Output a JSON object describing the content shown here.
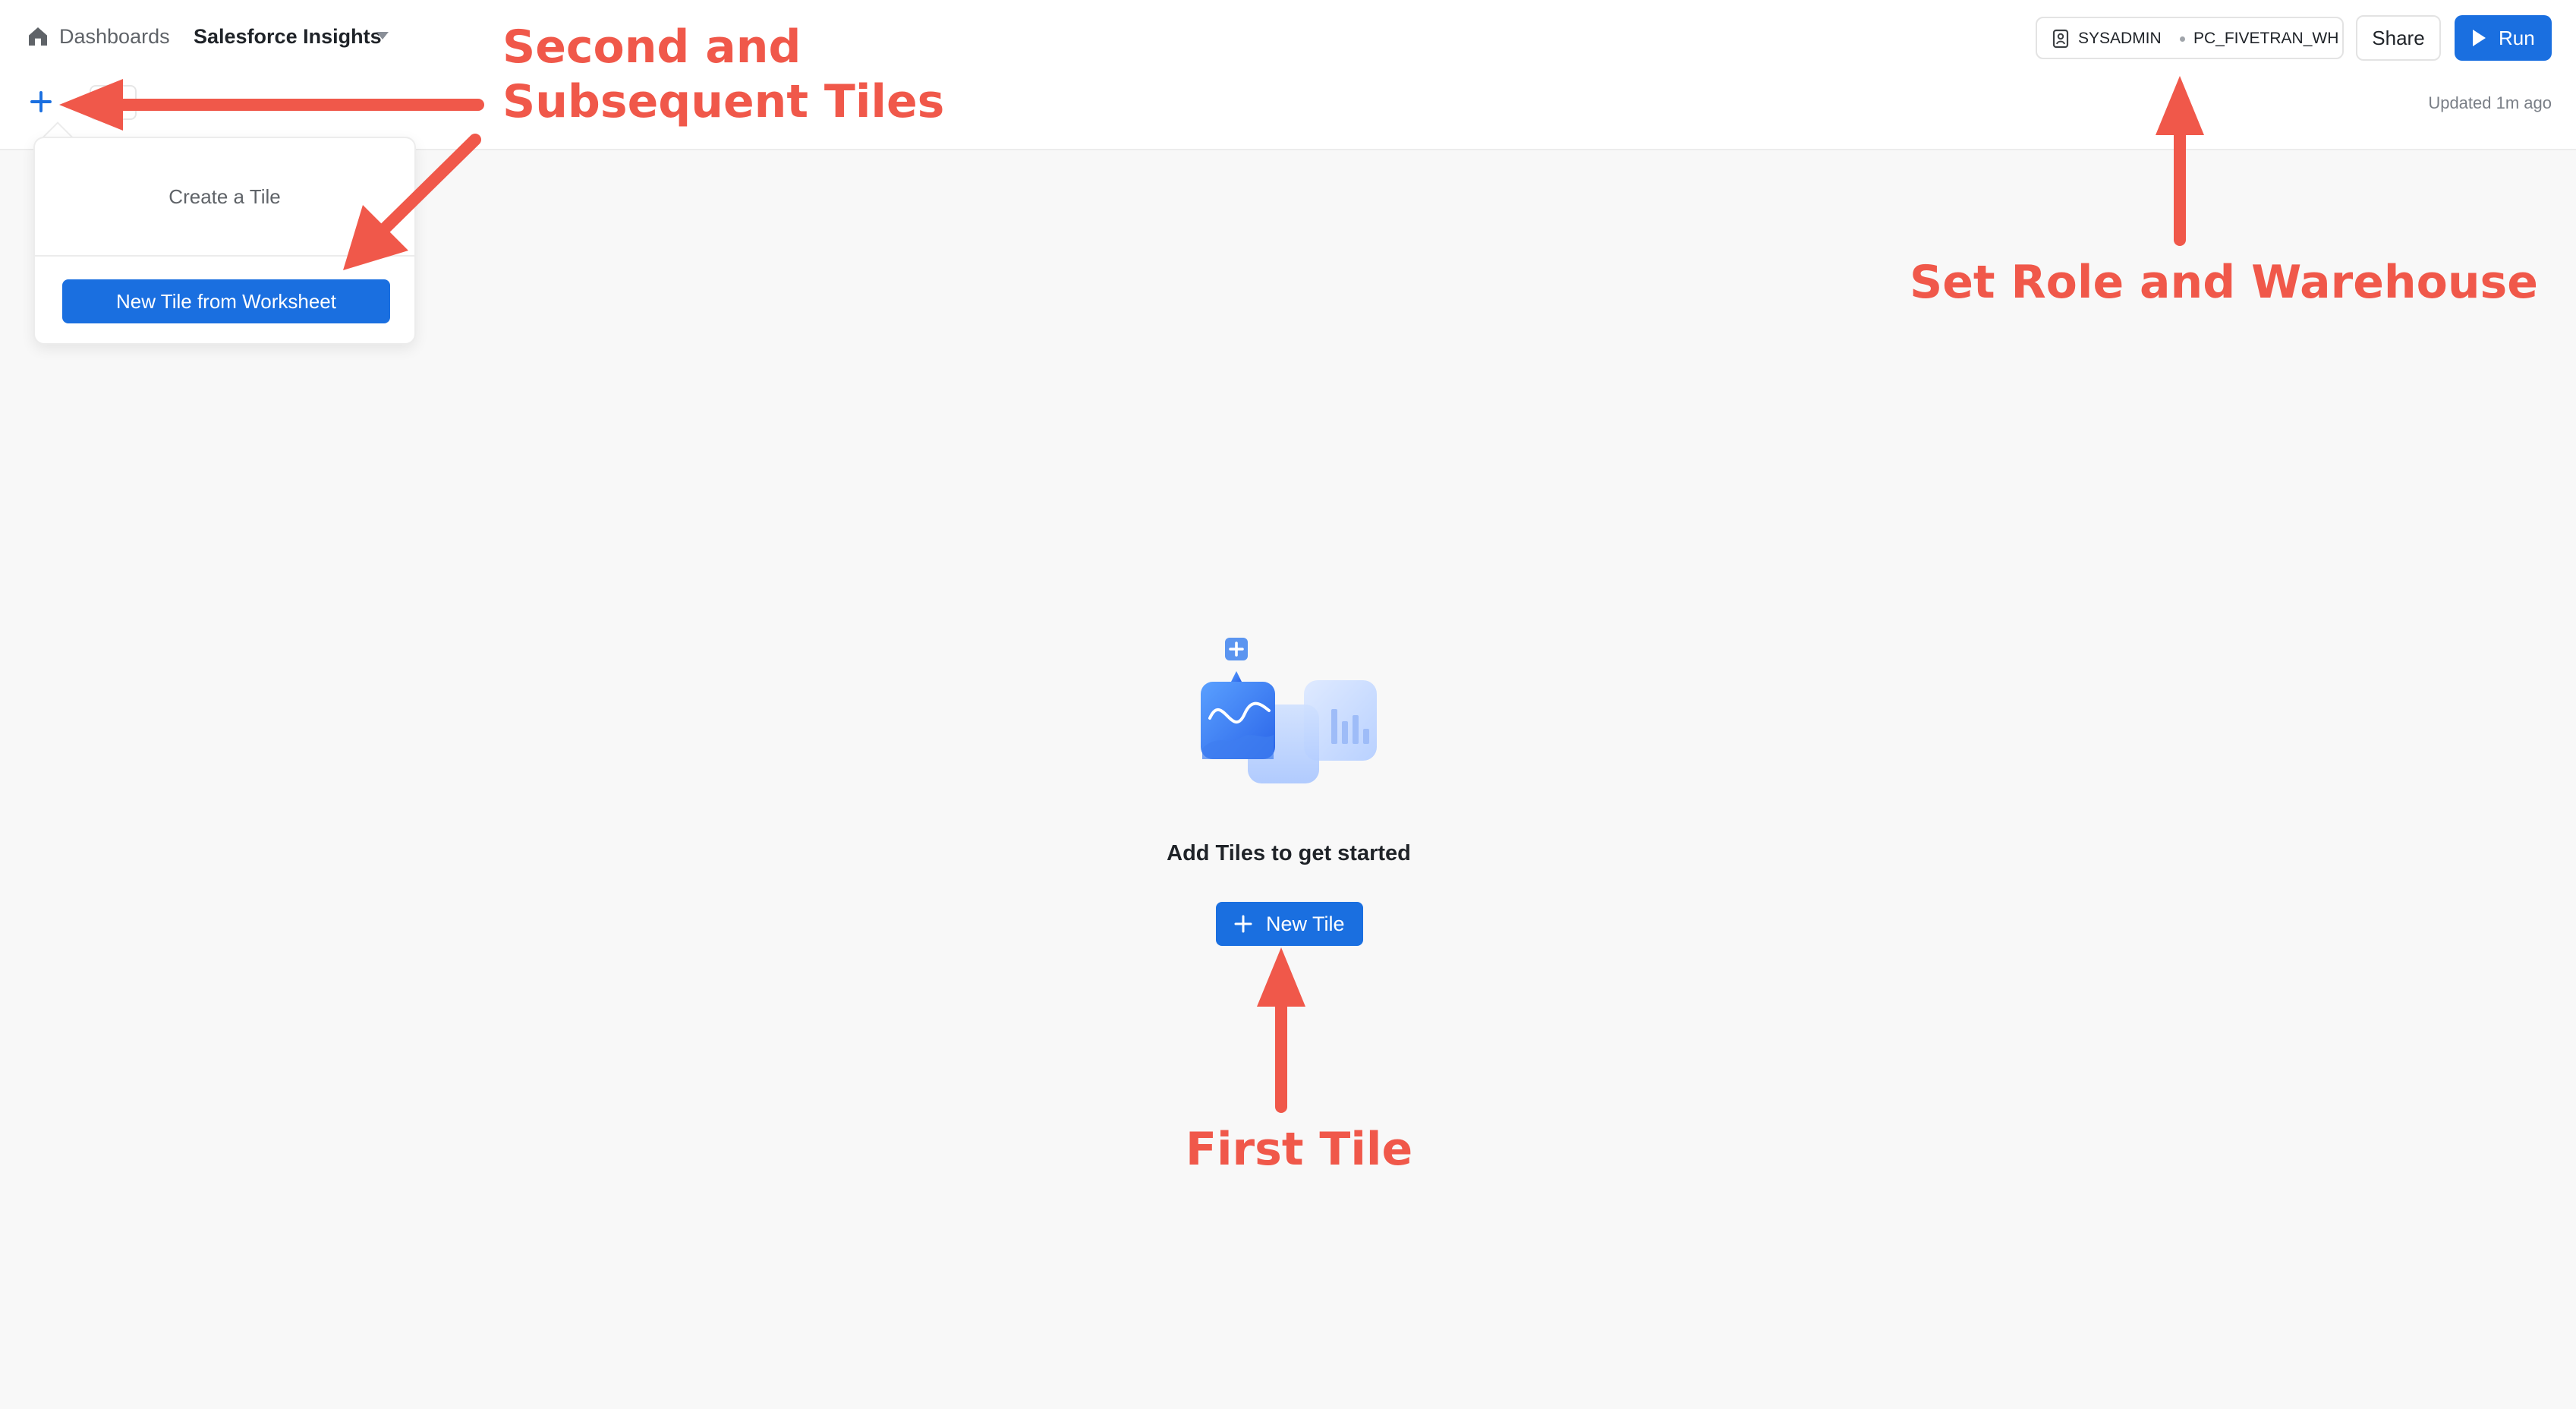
{
  "header": {
    "breadcrumb_root": "Dashboards",
    "dashboard_title": "Salesforce Insights",
    "role": "SYSADMIN",
    "warehouse": "PC_FIVETRAN_WH",
    "share_label": "Share",
    "run_label": "Run",
    "updated": "Updated 1m ago"
  },
  "popover": {
    "title": "Create a Tile",
    "action_label": "New Tile from Worksheet"
  },
  "empty_state": {
    "title": "Add Tiles to get started",
    "button_label": "New Tile"
  },
  "annotations": {
    "second_line1": "Second and",
    "second_line2": "Subsequent Tiles",
    "role_warehouse": "Set Role and Warehouse",
    "first_tile": "First Tile"
  },
  "colors": {
    "accent": "#1a6fe0",
    "annotation": "#f0584a",
    "background": "#f8f8f8"
  },
  "icons": [
    "home-icon",
    "chevron-down-icon",
    "plus-icon",
    "role-icon",
    "play-icon"
  ]
}
